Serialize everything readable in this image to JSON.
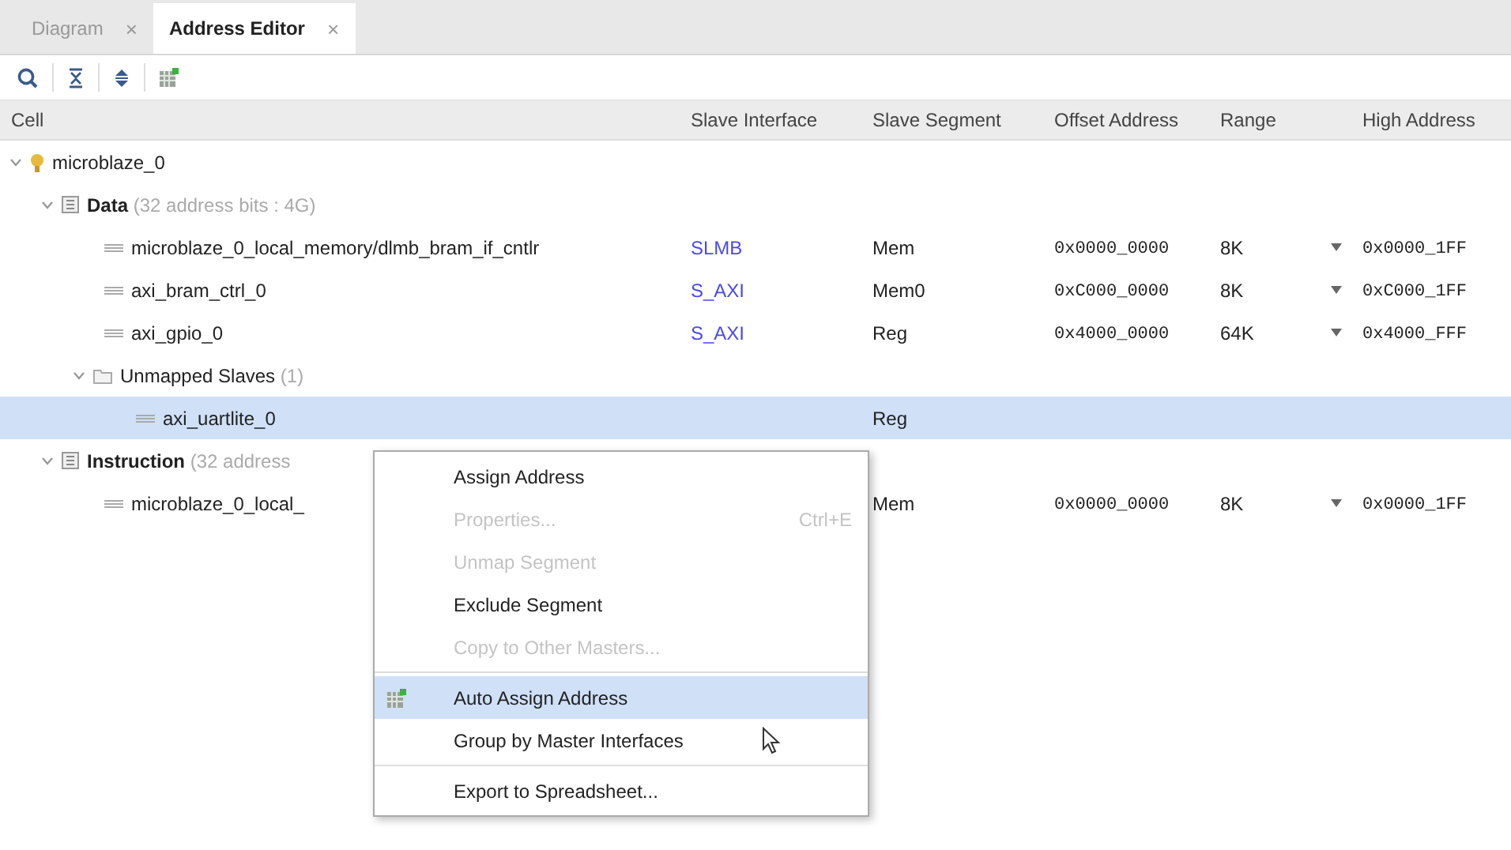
{
  "tabs": [
    {
      "label": "Diagram",
      "selected": false,
      "close": "×"
    },
    {
      "label": "Address Editor",
      "selected": true,
      "close": "×"
    }
  ],
  "table": {
    "columns": [
      "Cell",
      "Slave Interface",
      "Slave Segment",
      "Offset Address",
      "Range",
      "High Address"
    ],
    "rows": [
      {
        "kind": "master",
        "cell": "microblaze_0",
        "expanded": true,
        "selected": false,
        "children": [
          {
            "kind": "space",
            "cell": "Data",
            "detail": "(32 address bits : 4G)",
            "expanded": true,
            "selected": false,
            "children": [
              {
                "kind": "segment",
                "cell": "microblaze_0_local_memory/dlmb_bram_if_cntlr",
                "selected": false,
                "slave_interface": "SLMB",
                "slave_segment": "Mem",
                "offset": "0x0000_0000",
                "range": "8K",
                "high": "0x0000_1FF"
              },
              {
                "kind": "segment",
                "cell": "axi_bram_ctrl_0",
                "selected": false,
                "slave_interface": "S_AXI",
                "slave_segment": "Mem0",
                "offset": "0xC000_0000",
                "range": "8K",
                "high": "0xC000_1FF"
              },
              {
                "kind": "segment",
                "cell": "axi_gpio_0",
                "selected": false,
                "slave_interface": "S_AXI",
                "slave_segment": "Reg",
                "offset": "0x4000_0000",
                "range": "64K",
                "high": "0x4000_FFF"
              },
              {
                "kind": "group",
                "cell": "Unmapped Slaves",
                "detail": "(1)",
                "expanded": true,
                "selected": false,
                "children": [
                  {
                    "kind": "segment",
                    "cell": "axi_uartlite_0",
                    "selected": true,
                    "slave_segment": "Reg"
                  }
                ]
              }
            ]
          },
          {
            "kind": "space",
            "cell": "Instruction",
            "detail": "(32 address",
            "expanded": true,
            "selected": false,
            "children": [
              {
                "kind": "segment",
                "cell": "microblaze_0_local_",
                "selected": false,
                "slave_segment": "Mem",
                "offset": "0x0000_0000",
                "range": "8K",
                "high": "0x0000_1FF"
              }
            ]
          }
        ]
      }
    ]
  },
  "context_menu": {
    "items": [
      {
        "label": "Assign Address",
        "disabled": false,
        "selected": false,
        "kind": "plain"
      },
      {
        "label": "Properties...",
        "shortcut": "Ctrl+E",
        "disabled": true,
        "selected": false,
        "kind": "plain"
      },
      {
        "label": "Unmap Segment",
        "disabled": true,
        "selected": false,
        "kind": "plain"
      },
      {
        "label": "Exclude Segment",
        "disabled": false,
        "selected": false,
        "kind": "plain"
      },
      {
        "label": "Copy to Other Masters...",
        "disabled": true,
        "selected": false,
        "kind": "plain"
      },
      {
        "label": "Auto Assign Address",
        "disabled": false,
        "selected": true,
        "kind": "icon",
        "separator_before": true
      },
      {
        "label": "Group by Master Interfaces",
        "disabled": false,
        "selected": false,
        "kind": "plain"
      },
      {
        "label": "Export to Spreadsheet...",
        "disabled": false,
        "selected": false,
        "kind": "plain",
        "separator_before": true
      }
    ]
  }
}
